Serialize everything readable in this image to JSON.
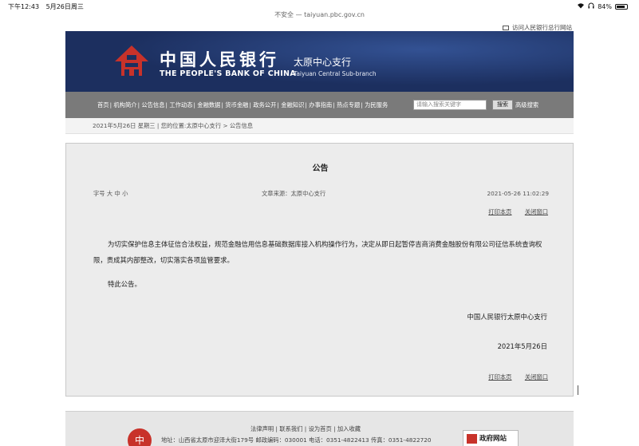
{
  "status_bar": {
    "time": "下午12:43",
    "date": "5月26日周三",
    "battery": "84%",
    "battery_level": 0.84
  },
  "browser": {
    "url": "不安全 — taiyuan.pbc.gov.cn"
  },
  "top_link": "访问人民银行总行网站",
  "header": {
    "title_cn": "中国人民银行",
    "title_en": "THE PEOPLE'S BANK OF CHINA",
    "branch_cn": "太原中心支行",
    "branch_en": "Taiyuan  Central  Sub-branch"
  },
  "nav": {
    "items": [
      "首页",
      "机构简介",
      "公告信息",
      "工作动态",
      "金融数据",
      "货币金融",
      "政务公开",
      "金融知识",
      "办事指南",
      "热点专题",
      "为民服务"
    ],
    "search_placeholder": "请输入搜索关键字",
    "search_button": "搜索",
    "advanced": "高级搜索"
  },
  "breadcrumb": "2021年5月26日 星期三  |  您的位置:太原中心支行 > 公告信息",
  "article": {
    "title": "公告",
    "number": "字号 大 中 小",
    "source": "文章来源：太原中心支行",
    "datetime": "2021-05-26 11:02:29",
    "print": "打印本页",
    "close": "关闭窗口",
    "body": "为切实保护信息主体征信合法权益，规范金融信用信息基础数据库接入机构操作行为，决定从即日起暂停吉商消费金融股份有限公司征信系统查询权限，责成其内部整改，切实落实各项监管要求。",
    "closing": "特此公告。",
    "signature": "中国人民银行太原中心支行",
    "date": "2021年5月26日"
  },
  "footer": {
    "links": "法律声明 | 联系我们 | 设为首页 | 加入收藏",
    "address": "地址：山西省太原市迎泽大街179号  邮政编码：030001  电话：0351-4822413  传真：0351-4822720",
    "gov_badge": "政府网站",
    "emblem": "中"
  }
}
